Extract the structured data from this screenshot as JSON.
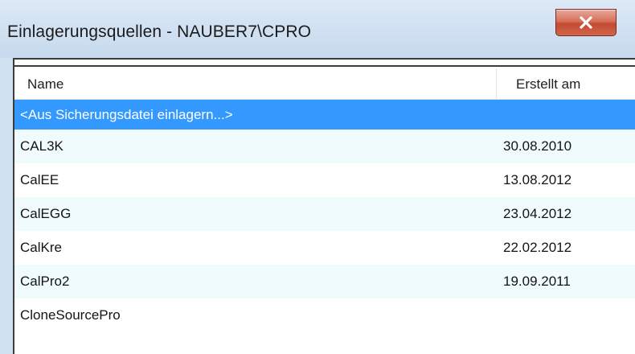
{
  "window": {
    "title": "Einlagerungsquellen - NAUBER7\\CPRO",
    "close_icon": "close-icon"
  },
  "columns": {
    "name": "Name",
    "created": "Erstellt am"
  },
  "rows": [
    {
      "name": "<Aus Sicherungsdatei einlagern...>",
      "created": "",
      "selected": true
    },
    {
      "name": "CAL3K",
      "created": "30.08.2010"
    },
    {
      "name": "CalEE",
      "created": "13.08.2012"
    },
    {
      "name": "CalEGG",
      "created": "23.04.2012"
    },
    {
      "name": "CalKre",
      "created": "22.02.2012"
    },
    {
      "name": "CalPro2",
      "created": "19.09.2011"
    },
    {
      "name": "CloneSourcePro",
      "created": ""
    }
  ],
  "colors": {
    "selection": "#3399ff",
    "alt_row": "#f0fbfe",
    "close_button": "#c44b32"
  }
}
